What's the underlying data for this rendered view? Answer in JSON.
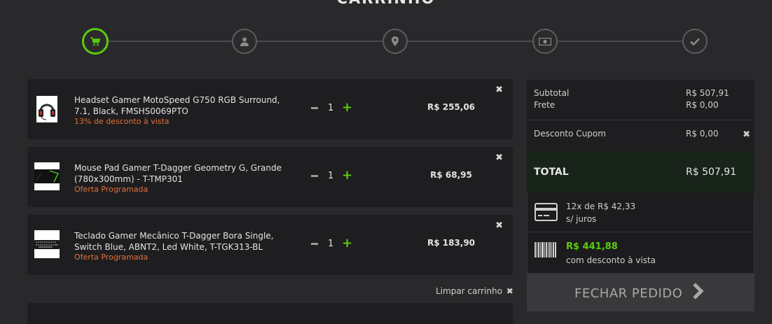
{
  "page_title": "CARRINHO",
  "steps": [
    {
      "name": "cart",
      "icon": "cart-icon",
      "active": true
    },
    {
      "name": "user",
      "icon": "user-icon",
      "active": false
    },
    {
      "name": "address",
      "icon": "map-pin-icon",
      "active": false
    },
    {
      "name": "payment",
      "icon": "money-icon",
      "active": false
    },
    {
      "name": "confirm",
      "icon": "check-icon",
      "active": false
    }
  ],
  "items": [
    {
      "name": "Headset Gamer MotoSpeed G750 RGB Surround, 7.1, Black, FMSHS0069PTO",
      "promo": "13% de desconto à vista",
      "qty": "1",
      "price": "R$ 255,06",
      "thumb_icon": "headset-icon"
    },
    {
      "name": "Mouse Pad Gamer T-Dagger Geometry G, Grande (780x300mm) - T-TMP301",
      "promo": "Oferta Programada",
      "qty": "1",
      "price": "R$ 68,95",
      "thumb_icon": "mousepad-icon"
    },
    {
      "name": "Teclado Gamer Mecânico T-Dagger Bora Single, Switch Blue, ABNT2, Led White, T-TGK313-BL",
      "promo": "Oferta Programada",
      "qty": "1",
      "price": "R$ 183,90",
      "thumb_icon": "keyboard-icon"
    }
  ],
  "remove_symbol": "✖",
  "clear_cart": "Limpar carrinho",
  "summary": {
    "subtotal_label": "Subtotal",
    "subtotal_value": "R$ 507,91",
    "shipping_label": "Frete",
    "shipping_value": "R$ 0,00",
    "coupon_label": "Desconto Cupom",
    "coupon_value": "R$ 0,00",
    "total_label": "TOTAL",
    "total_value": "R$ 507,91",
    "installments_line1": "12x de R$ 42,33",
    "installments_line2": "s/ juros",
    "cash_price": "R$ 441,88",
    "cash_label": "com desconto à vista",
    "checkout_label": "FECHAR PEDIDO"
  },
  "colors": {
    "accent": "#5bcc0f",
    "promo": "#e2713a"
  }
}
